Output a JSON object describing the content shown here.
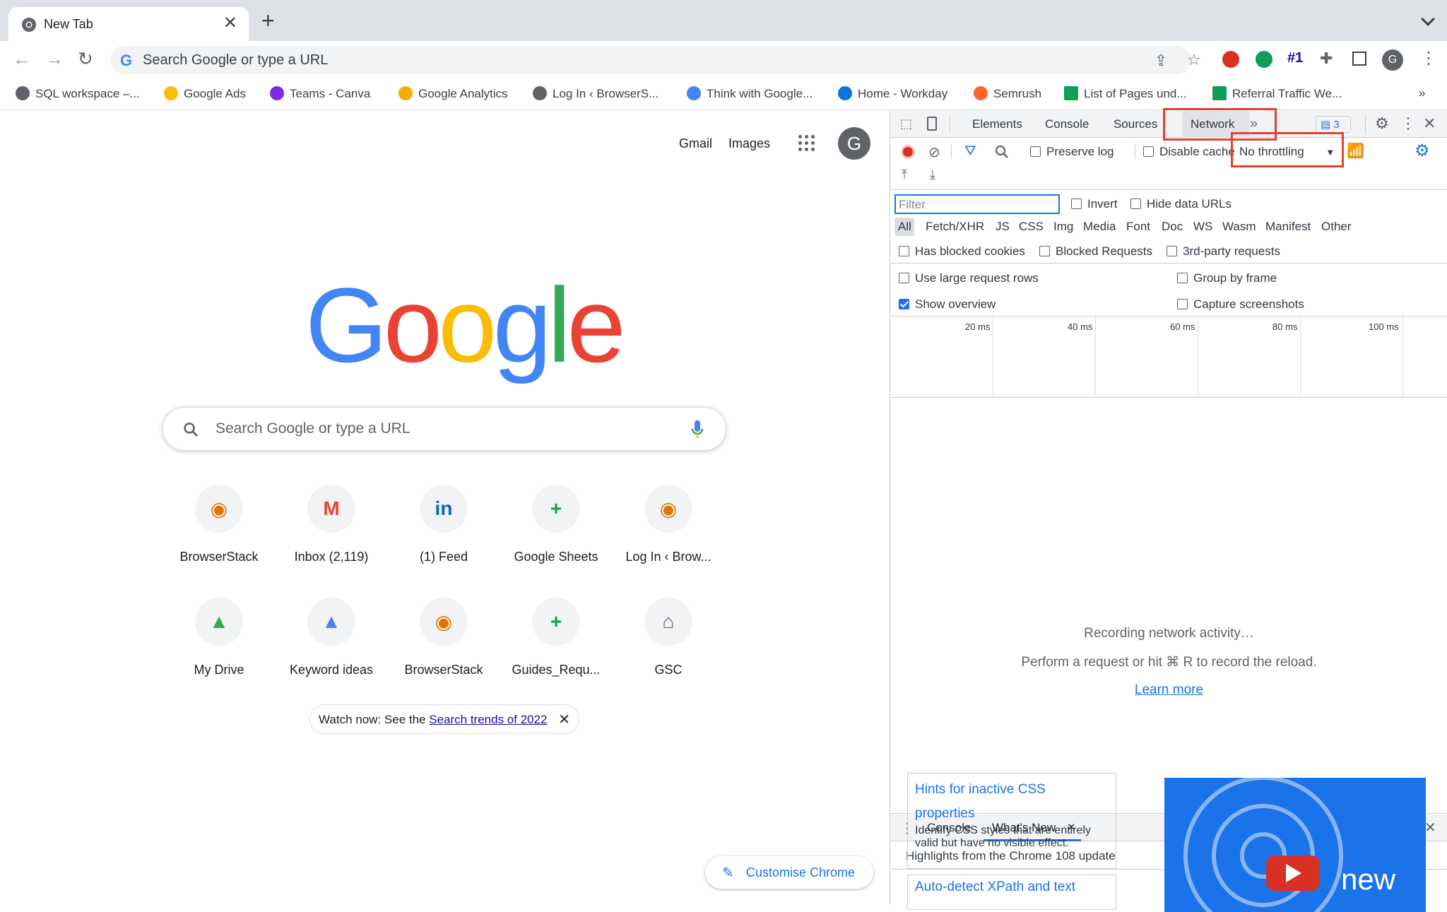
{
  "window": {
    "tab_title": "New Tab",
    "tab_close": "✕",
    "new_tab": "+"
  },
  "toolbar": {
    "omnibox_placeholder": "Search Google or type a URL",
    "ext_number": "#1"
  },
  "bookmarks": [
    {
      "label": "SQL workspace –...",
      "color": "#5f6368"
    },
    {
      "label": "Google Ads",
      "color": "#fbbc04"
    },
    {
      "label": "Teams - Canva",
      "color": "#7d2ae8"
    },
    {
      "label": "Google Analytics",
      "color": "#f9ab00"
    },
    {
      "label": "Log In ‹ BrowserS...",
      "color": "#5f6368"
    },
    {
      "label": "Think with Google...",
      "color": "#4285f4"
    },
    {
      "label": "Home - Workday",
      "color": "#0875e1"
    },
    {
      "label": "Semrush",
      "color": "#ff642d"
    },
    {
      "label": "List of Pages und...",
      "color": "#0f9d58"
    },
    {
      "label": "Referral Traffic We...",
      "color": "#0f9d58"
    }
  ],
  "bookmarks_overflow": "»",
  "page": {
    "gmail": "Gmail",
    "images": "Images",
    "avatar": "G",
    "logo_letters": [
      {
        "ch": "G",
        "color": "#4285f4"
      },
      {
        "ch": "o",
        "color": "#ea4335"
      },
      {
        "ch": "o",
        "color": "#fbbc05"
      },
      {
        "ch": "g",
        "color": "#4285f4"
      },
      {
        "ch": "l",
        "color": "#34a853"
      },
      {
        "ch": "e",
        "color": "#ea4335"
      }
    ],
    "search_placeholder": "Search Google or type a URL",
    "shortcuts": [
      {
        "label": "BrowserStack",
        "glyph": "◉",
        "color": "#e37400"
      },
      {
        "label": "Inbox (2,119)",
        "glyph": "M",
        "color": "#ea4335"
      },
      {
        "label": "(1) Feed",
        "glyph": "in",
        "color": "#0a66c2"
      },
      {
        "label": "Google Sheets",
        "glyph": "+",
        "color": "#0f9d58"
      },
      {
        "label": "Log In ‹ Brow...",
        "glyph": "◉",
        "color": "#e37400"
      },
      {
        "label": "My Drive",
        "glyph": "▲",
        "color": "#34a853"
      },
      {
        "label": "Keyword ideas",
        "glyph": "▲",
        "color": "#4285f4"
      },
      {
        "label": "BrowserStack",
        "glyph": "◉",
        "color": "#e37400"
      },
      {
        "label": "Guides_Requ...",
        "glyph": "+",
        "color": "#0f9d58"
      },
      {
        "label": "GSC",
        "glyph": "⌂",
        "color": "#5f6368"
      }
    ],
    "promo_prefix": "Watch now: See the ",
    "promo_link": "Search trends of 2022",
    "promo_close": "✕",
    "customise": "Customise Chrome"
  },
  "devtools": {
    "tabs": [
      "Elements",
      "Console",
      "Sources",
      "Network"
    ],
    "active_tab": "Network",
    "issues_count": "3",
    "preserve_log": "Preserve log",
    "disable_cache": "Disable cache",
    "throttling": "No throttling",
    "filter_placeholder": "Filter",
    "invert": "Invert",
    "hide_data_urls": "Hide data URLs",
    "types": [
      "All",
      "Fetch/XHR",
      "JS",
      "CSS",
      "Img",
      "Media",
      "Font",
      "Doc",
      "WS",
      "Wasm",
      "Manifest",
      "Other"
    ],
    "has_blocked_cookies": "Has blocked cookies",
    "blocked_requests": "Blocked Requests",
    "third_party": "3rd-party requests",
    "large_rows": "Use large request rows",
    "group_by_frame": "Group by frame",
    "show_overview": "Show overview",
    "capture_screenshots": "Capture screenshots",
    "ticks": [
      "20 ms",
      "40 ms",
      "60 ms",
      "80 ms",
      "100 ms"
    ],
    "recording": "Recording network activity…",
    "perform": "Perform a request or hit ⌘ R to record the reload.",
    "learn_more": "Learn more",
    "drawer_tabs": [
      "Console",
      "What's New"
    ],
    "drawer_close_tab": "✕",
    "highlights": "Highlights from the Chrome 108 update",
    "card1_title": "Hints for inactive CSS properties",
    "card1_body": "Identify CSS styles that are entirely valid but have no visible effect.",
    "card2_title": "Auto-detect XPath and text",
    "promo_new": "new"
  }
}
